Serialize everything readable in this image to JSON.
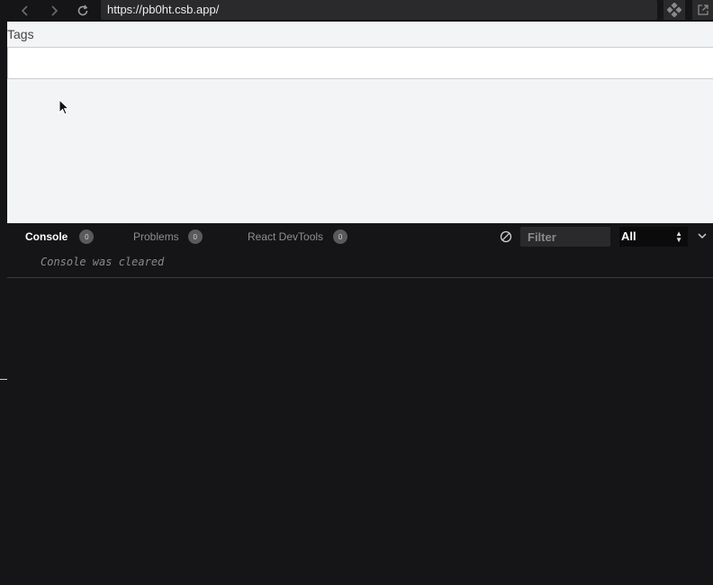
{
  "browser": {
    "url": "https://pb0ht.csb.app/",
    "icons": {
      "back": "chevron-left-icon",
      "forward": "chevron-right-icon",
      "reload": "reload-icon",
      "devtools": "devtools-diamond-icon",
      "open_new_window": "external-window-icon"
    }
  },
  "preview": {
    "tags_label": "Tags",
    "tags_input_value": ""
  },
  "devtools": {
    "tabs": [
      {
        "label": "Console",
        "count": "0",
        "active": true
      },
      {
        "label": "Problems",
        "count": "0",
        "active": false
      },
      {
        "label": "React DevTools",
        "count": "0",
        "active": false
      }
    ],
    "filter_placeholder": "Filter",
    "level": "All",
    "messages": [
      "Console was cleared"
    ]
  },
  "colors": {
    "background": "#151416",
    "preview_bg": "#f3f4f6",
    "url_bar": "#2a2a2c",
    "count_badge": "#5a5a5a"
  }
}
